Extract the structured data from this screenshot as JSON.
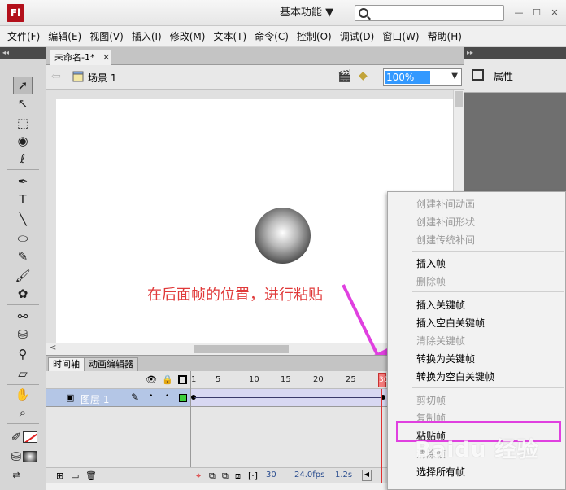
{
  "app": {
    "logo": "Fl",
    "workspace": "基本功能 ▼"
  },
  "window_controls": {
    "minimize": "—",
    "restore": "☐",
    "close": "✕"
  },
  "menubar": [
    "文件(F)",
    "编辑(E)",
    "视图(V)",
    "插入(I)",
    "修改(M)",
    "文本(T)",
    "命令(C)",
    "控制(O)",
    "调试(D)",
    "窗口(W)",
    "帮助(H)"
  ],
  "document": {
    "tab_label": "未命名-1*",
    "scene_label": "场景 1",
    "zoom": "100%"
  },
  "annotation": "在后面帧的位置，进行粘贴",
  "timeline": {
    "tabs": [
      "时间轴",
      "动画编辑器"
    ],
    "layer_name": "图层 1",
    "frame_numbers": [
      "1",
      "5",
      "10",
      "15",
      "20",
      "25",
      "30"
    ],
    "playhead_frame": "30",
    "footer": {
      "current_frame": "30",
      "fps": "24.0fps",
      "time": "1.2s"
    }
  },
  "properties": {
    "title": "属性"
  },
  "context_menu": {
    "items": [
      {
        "label": "创建补间动画",
        "enabled": false
      },
      {
        "label": "创建补间形状",
        "enabled": false
      },
      {
        "label": "创建传统补间",
        "enabled": false
      },
      {
        "label": "插入帧",
        "enabled": true
      },
      {
        "label": "删除帧",
        "enabled": false
      },
      {
        "label": "插入关键帧",
        "enabled": true
      },
      {
        "label": "插入空白关键帧",
        "enabled": true
      },
      {
        "label": "清除关键帧",
        "enabled": false
      },
      {
        "label": "转换为关键帧",
        "enabled": true
      },
      {
        "label": "转换为空白关键帧",
        "enabled": true
      },
      {
        "label": "剪切帧",
        "enabled": false
      },
      {
        "label": "复制帧",
        "enabled": false
      },
      {
        "label": "粘贴帧",
        "enabled": true
      },
      {
        "label": "清除帧",
        "enabled": false
      },
      {
        "label": "选择所有帧",
        "enabled": true
      }
    ],
    "highlighted": "粘贴帧"
  },
  "watermark": "Baidu 经验",
  "colors": {
    "annotation": "#e03a3a",
    "highlight_box": "#e040e0",
    "arrow": "#e040e0",
    "zoom_selected": "#3399ff"
  }
}
